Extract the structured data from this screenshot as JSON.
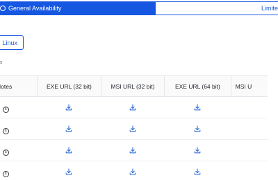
{
  "tabs": {
    "active": "General Availability",
    "inactive": "Limite"
  },
  "os_button": "Linux",
  "versions_label": "ns",
  "table": {
    "columns": [
      "Notes",
      "EXE URL (32 bit)",
      "MSI URL (32 bit)",
      "EXE URL (64 bit)",
      "MSI U"
    ],
    "rows": [
      {
        "notes": "info-icon",
        "exe32": "download-icon",
        "msi32": "download-icon",
        "exe64": "download-icon"
      },
      {
        "notes": "info-icon",
        "exe32": "download-icon",
        "msi32": "download-icon",
        "exe64": "download-icon"
      },
      {
        "notes": "info-icon",
        "exe32": "download-icon",
        "msi32": "download-icon",
        "exe64": "download-icon"
      },
      {
        "notes": "info-icon",
        "exe32": "download-icon",
        "msi32": "download-icon",
        "exe64": "download-icon"
      }
    ]
  },
  "colors": {
    "accent": "#1557e0",
    "download_icon": "#2f6bd8"
  }
}
